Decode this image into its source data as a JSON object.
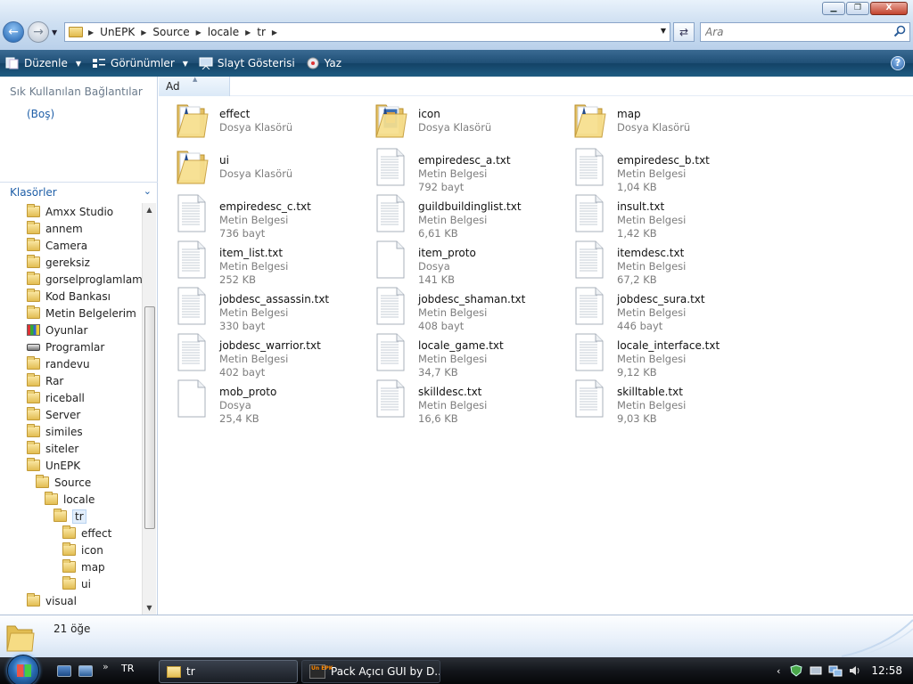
{
  "window": {
    "buttons": {
      "minimize": "▁",
      "maximize": "❐",
      "close": "X"
    }
  },
  "address": {
    "crumbs": [
      "UnEPK",
      "Source",
      "locale",
      "tr"
    ]
  },
  "search": {
    "placeholder": "Ara"
  },
  "toolbar": {
    "organize": "Düzenle",
    "views": "Görünümler",
    "slideshow": "Slayt Gösterisi",
    "burn": "Yaz",
    "help": "?"
  },
  "left_pane": {
    "favorites_header": "Sık Kullanılan Bağlantılar",
    "favorites_empty": "(Boş)",
    "folders_header": "Klasörler",
    "tree": [
      {
        "label": "Amxx Studio",
        "indent": 0,
        "icon": "folder-icon"
      },
      {
        "label": "annem",
        "indent": 0,
        "icon": "folder-icon"
      },
      {
        "label": "Camera",
        "indent": 0,
        "icon": "folder-icon"
      },
      {
        "label": "gereksiz",
        "indent": 0,
        "icon": "folder-icon"
      },
      {
        "label": "gorselproglamlama",
        "indent": 0,
        "icon": "folder-icon"
      },
      {
        "label": "Kod Bankası",
        "indent": 0,
        "icon": "folder-icon"
      },
      {
        "label": "Metin Belgelerim",
        "indent": 0,
        "icon": "folder-icon"
      },
      {
        "label": "Oyunlar",
        "indent": 0,
        "icon": "games-icon"
      },
      {
        "label": "Programlar",
        "indent": 0,
        "icon": "programs-icon"
      },
      {
        "label": "randevu",
        "indent": 0,
        "icon": "folder-icon"
      },
      {
        "label": "Rar",
        "indent": 0,
        "icon": "folder-icon"
      },
      {
        "label": "riceball",
        "indent": 0,
        "icon": "folder-icon"
      },
      {
        "label": "Server",
        "indent": 0,
        "icon": "folder-icon"
      },
      {
        "label": "similes",
        "indent": 0,
        "icon": "folder-icon"
      },
      {
        "label": "siteler",
        "indent": 0,
        "icon": "folder-icon"
      },
      {
        "label": "UnEPK",
        "indent": 0,
        "icon": "folder-icon"
      },
      {
        "label": "Source",
        "indent": 1,
        "icon": "folder-icon"
      },
      {
        "label": "locale",
        "indent": 2,
        "icon": "folder-icon"
      },
      {
        "label": "tr",
        "indent": 3,
        "icon": "folder-icon",
        "selected": true
      },
      {
        "label": "effect",
        "indent": 4,
        "icon": "folder-icon"
      },
      {
        "label": "icon",
        "indent": 4,
        "icon": "folder-icon"
      },
      {
        "label": "map",
        "indent": 4,
        "icon": "folder-icon"
      },
      {
        "label": "ui",
        "indent": 4,
        "icon": "folder-icon"
      },
      {
        "label": "visual",
        "indent": 0,
        "icon": "folder-icon"
      }
    ]
  },
  "columns": {
    "name": "Ad"
  },
  "files": [
    {
      "name": "effect",
      "type": "Dosya Klasörü",
      "size": "",
      "icon": "folder-icon"
    },
    {
      "name": "icon",
      "type": "Dosya Klasörü",
      "size": "",
      "icon": "image-folder-icon"
    },
    {
      "name": "map",
      "type": "Dosya Klasörü",
      "size": "",
      "icon": "folder-icon"
    },
    {
      "name": "ui",
      "type": "Dosya Klasörü",
      "size": "",
      "icon": "folder-icon"
    },
    {
      "name": "empiredesc_a.txt",
      "type": "Metin Belgesi",
      "size": "792 bayt",
      "icon": "text-file-icon"
    },
    {
      "name": "empiredesc_b.txt",
      "type": "Metin Belgesi",
      "size": "1,04 KB",
      "icon": "text-file-icon"
    },
    {
      "name": "empiredesc_c.txt",
      "type": "Metin Belgesi",
      "size": "736 bayt",
      "icon": "text-file-icon"
    },
    {
      "name": "guildbuildinglist.txt",
      "type": "Metin Belgesi",
      "size": "6,61 KB",
      "icon": "text-file-icon"
    },
    {
      "name": "insult.txt",
      "type": "Metin Belgesi",
      "size": "1,42 KB",
      "icon": "text-file-icon"
    },
    {
      "name": "item_list.txt",
      "type": "Metin Belgesi",
      "size": "252 KB",
      "icon": "text-file-icon"
    },
    {
      "name": "item_proto",
      "type": "Dosya",
      "size": "141 KB",
      "icon": "blank-file-icon"
    },
    {
      "name": "itemdesc.txt",
      "type": "Metin Belgesi",
      "size": "67,2 KB",
      "icon": "text-file-icon"
    },
    {
      "name": "jobdesc_assassin.txt",
      "type": "Metin Belgesi",
      "size": "330 bayt",
      "icon": "text-file-icon"
    },
    {
      "name": "jobdesc_shaman.txt",
      "type": "Metin Belgesi",
      "size": "408 bayt",
      "icon": "text-file-icon"
    },
    {
      "name": "jobdesc_sura.txt",
      "type": "Metin Belgesi",
      "size": "446 bayt",
      "icon": "text-file-icon"
    },
    {
      "name": "jobdesc_warrior.txt",
      "type": "Metin Belgesi",
      "size": "402 bayt",
      "icon": "text-file-icon"
    },
    {
      "name": "locale_game.txt",
      "type": "Metin Belgesi",
      "size": "34,7 KB",
      "icon": "text-file-icon"
    },
    {
      "name": "locale_interface.txt",
      "type": "Metin Belgesi",
      "size": "9,12 KB",
      "icon": "text-file-icon"
    },
    {
      "name": "mob_proto",
      "type": "Dosya",
      "size": "25,4 KB",
      "icon": "blank-file-icon"
    },
    {
      "name": "skilldesc.txt",
      "type": "Metin Belgesi",
      "size": "16,6 KB",
      "icon": "text-file-icon"
    },
    {
      "name": "skilltable.txt",
      "type": "Metin Belgesi",
      "size": "9,03 KB",
      "icon": "text-file-icon"
    }
  ],
  "details": {
    "count": "21 öğe"
  },
  "taskbar": {
    "language": "TR",
    "quicklaunch_more": "»",
    "tasks": [
      {
        "label": "tr",
        "active": true,
        "icon": "folder-icon"
      },
      {
        "label": "Pack Açıcı GUI by D...",
        "active": false,
        "icon": "app-icon",
        "icon_text": "Un EPK"
      }
    ],
    "clock": "12:58",
    "tray_chevron": "‹"
  },
  "colors": {
    "toolbar": "#1f4f76",
    "link": "#1f5fa8",
    "secondary_text": "#7d7d7d",
    "selection": "#e2eefb"
  }
}
